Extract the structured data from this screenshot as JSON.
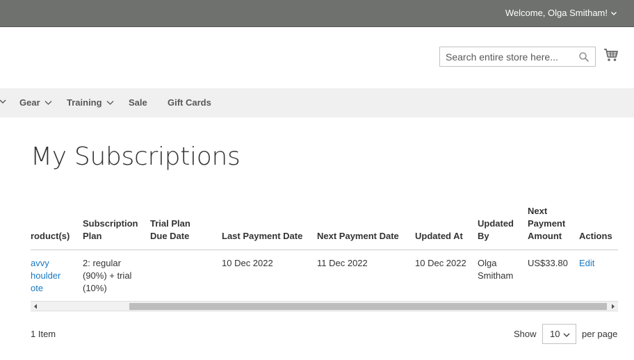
{
  "header": {
    "welcome_text": "Welcome, Olga Smitham!",
    "search_placeholder": "Search entire store here..."
  },
  "nav": {
    "items": [
      {
        "label": "Gear",
        "has_dropdown": true
      },
      {
        "label": "Training",
        "has_dropdown": true
      },
      {
        "label": "Sale",
        "has_dropdown": false
      },
      {
        "label": "Gift Cards",
        "has_dropdown": false
      }
    ]
  },
  "page": {
    "title": "My Subscriptions"
  },
  "table": {
    "columns": {
      "products": "roduct(s)",
      "plan_1": "Subscription",
      "plan_2": "Plan",
      "trial_1": "Trial Plan",
      "trial_2": "Due Date",
      "last_payment": "Last Payment Date",
      "next_payment": "Next Payment Date",
      "updated_at": "Updated At",
      "updated_by_1": "Updated",
      "updated_by_2": "By",
      "next_amount_1": "Next",
      "next_amount_2": "Payment",
      "next_amount_3": "Amount",
      "actions": "Actions"
    },
    "row": {
      "product_1": "avvy",
      "product_2": "houlder",
      "product_3": "ote",
      "plan_1": "2: regular",
      "plan_2": "(90%) + trial",
      "plan_3": "(10%)",
      "trial_due": "",
      "last_payment": "10 Dec 2022",
      "next_payment": "11 Dec 2022",
      "updated_at": "10 Dec 2022",
      "updated_by_1": "Olga",
      "updated_by_2": "Smitham",
      "next_amount": "US$33.80",
      "action_edit": "Edit"
    }
  },
  "toolbar": {
    "items_count": "1 Item",
    "show_label": "Show",
    "per_page_value": "10",
    "per_page_label": "per page"
  },
  "colors": {
    "topbar": "#6e716e",
    "navbar": "#f0f0f0",
    "link": "#1979c3"
  },
  "icons": {
    "search": "search-icon",
    "cart": "cart-icon",
    "chevron": "chevron-down-icon"
  }
}
